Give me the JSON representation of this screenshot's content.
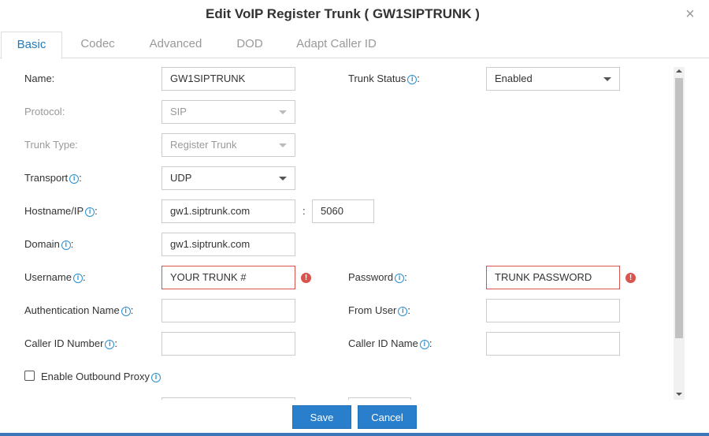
{
  "dialog": {
    "title": "Edit VoIP Register Trunk ( GW1SIPTRUNK )",
    "close_icon": "close-icon"
  },
  "tabs": [
    {
      "label": "Basic",
      "active": true
    },
    {
      "label": "Codec",
      "active": false
    },
    {
      "label": "Advanced",
      "active": false
    },
    {
      "label": "DOD",
      "active": false
    },
    {
      "label": "Adapt Caller ID",
      "active": false
    }
  ],
  "form": {
    "name": {
      "label": "Name:",
      "value": "GW1SIPTRUNK"
    },
    "trunk_status": {
      "label": "Trunk Status",
      "suffix": ":",
      "value": "Enabled"
    },
    "protocol": {
      "label": "Protocol:",
      "value": "SIP"
    },
    "trunk_type": {
      "label": "Trunk Type:",
      "value": "Register Trunk"
    },
    "transport": {
      "label": "Transport",
      "suffix": ":",
      "value": "UDP"
    },
    "hostname": {
      "label": "Hostname/IP",
      "suffix": ":",
      "value": "gw1.siptrunk.com",
      "separator": ":",
      "port": "5060"
    },
    "domain": {
      "label": "Domain",
      "suffix": ":",
      "value": "gw1.siptrunk.com"
    },
    "username": {
      "label": "Username",
      "suffix": ":",
      "value": "YOUR TRUNK #"
    },
    "password": {
      "label": "Password",
      "suffix": ":",
      "value": "TRUNK PASSWORD"
    },
    "auth_name": {
      "label": "Authentication Name",
      "suffix": ":",
      "value": ""
    },
    "from_user": {
      "label": "From User",
      "suffix": ":",
      "value": ""
    },
    "caller_id_number": {
      "label": "Caller ID Number",
      "suffix": ":",
      "value": ""
    },
    "caller_id_name": {
      "label": "Caller ID Name",
      "suffix": ":",
      "value": ""
    },
    "outbound_proxy": {
      "label": "Enable Outbound Proxy",
      "checked": false
    }
  },
  "info_glyph": "i",
  "error_glyph": "!",
  "buttons": {
    "save": "Save",
    "cancel": "Cancel"
  },
  "colors": {
    "accent": "#2a7fcc",
    "tab_active": "#1f7bbf",
    "error": "#d9534f"
  }
}
